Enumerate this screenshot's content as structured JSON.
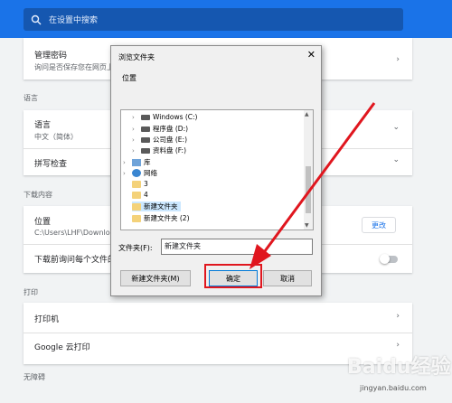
{
  "search": {
    "placeholder": "在设置中搜索"
  },
  "password": {
    "title": "管理密码",
    "desc": "询问是否保存您在网页上输入的密码"
  },
  "language_section": "语言",
  "language": {
    "title": "语言",
    "value": "中文（简体）"
  },
  "spellcheck": {
    "title": "拼写检查"
  },
  "downloads_section": "下载内容",
  "location": {
    "title": "位置",
    "value": "C:\\Users\\LHF\\Downloads",
    "change_label": "更改"
  },
  "ask_where": {
    "title": "下载前询问每个文件的保存位置"
  },
  "print_section": "打印",
  "printers": {
    "title": "打印机"
  },
  "cloud_print": {
    "title": "Google 云打印"
  },
  "accessibility_section": "无障碍",
  "dialog": {
    "title": "浏览文件夹",
    "close": "✕",
    "subtitle": "位置",
    "tree": [
      "Windows (C:)",
      "程序盘 (D:)",
      "公司盘 (E:)",
      "资料盘 (F:)",
      "库",
      "网络",
      "3",
      "4",
      "新建文件夹",
      "新建文件夹 (2)"
    ],
    "folder_label": "文件夹(F):",
    "folder_value": "新建文件夹",
    "new_folder_button": "新建文件夹(M)",
    "ok_button": "确定",
    "cancel_button": "取消"
  },
  "watermark": {
    "text": "Baidu经验",
    "url": "jingyan.baidu.com"
  },
  "colors": {
    "accent": "#1a73e8",
    "highlight": "#e0161e"
  }
}
